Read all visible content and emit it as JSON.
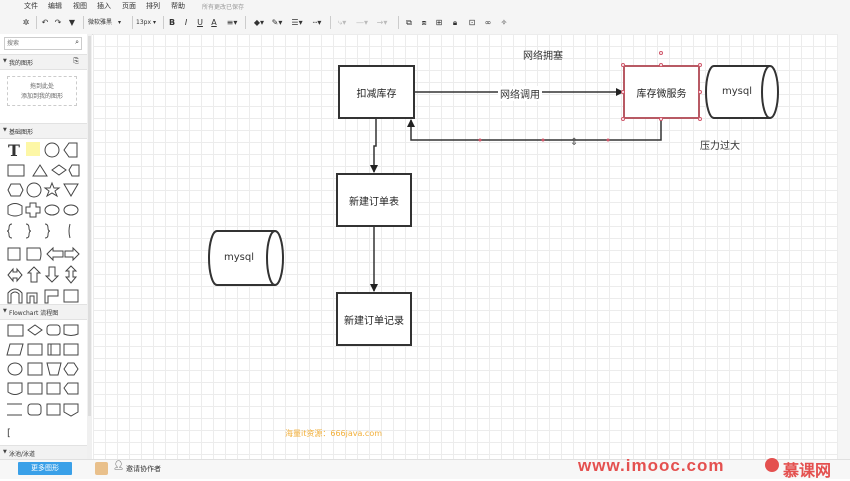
{
  "menu": [
    "文件",
    "编辑",
    "视图",
    "插入",
    "页面",
    "排列",
    "帮助"
  ],
  "save_status": "所有更改已保存",
  "toolbar": {
    "font_name": "微软雅黑",
    "font_size": "13px",
    "bold": "B",
    "italic": "I",
    "underline": "U",
    "font_color": "A"
  },
  "sidebar": {
    "search_placeholder": "搜索",
    "my_shapes_title": "我的图形",
    "drop_hint_line1": "拖到此处",
    "drop_hint_line2": "添加到我的图形",
    "basic_title": "基础图形",
    "text_tool": "T",
    "flowchart_title": "Flowchart 流程图",
    "bracket": "[",
    "swimlane_title": "泳池/泳道",
    "more_shapes_button": "更多图形"
  },
  "diagram": {
    "title": "网络拥塞",
    "nodes": {
      "deduct_stock": "扣减库存",
      "stock_service": "库存微服务",
      "mysql_right": "mysql",
      "new_order": "新建订单表",
      "new_order_record": "新建订单记录",
      "mysql_left": "mysql"
    },
    "edge_label": "网络调用",
    "overload_note": "压力过大"
  },
  "bottom": {
    "invite_collaborator": "邀请协作者"
  },
  "overlay": {
    "watermark_small": "海量it资源：666java.com",
    "watermark_site": "www.imooc.com",
    "brand": "慕课网"
  },
  "colors": {
    "accent_button": "#3aa0e8",
    "selection": "#d0576a",
    "watermark": "#e4504f"
  }
}
